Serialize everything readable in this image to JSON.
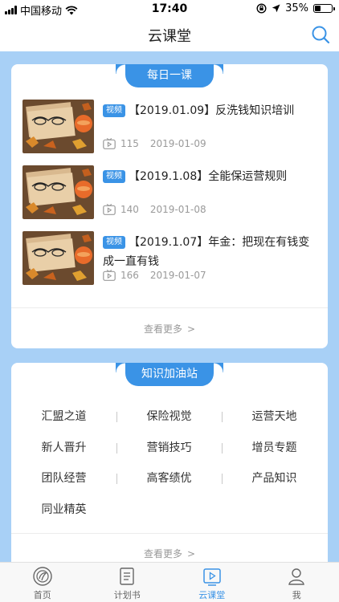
{
  "status_bar": {
    "carrier": "中国移动",
    "time": "17:40",
    "battery_text": "35%",
    "battery_level": 0.35
  },
  "nav": {
    "title": "云课堂",
    "search_icon": "search-icon"
  },
  "daily_lesson": {
    "tab_label": "每日一课",
    "badge_label": "视频",
    "items": [
      {
        "title": "【2019.01.09】反洗钱知识培训",
        "views": "115",
        "date": "2019-01-09"
      },
      {
        "title": "【2019.1.08】全能保运营规则",
        "views": "140",
        "date": "2019-01-08"
      },
      {
        "title": "【2019.1.07】年金：把现在有钱变成一直有钱",
        "views": "166",
        "date": "2019-01-07"
      }
    ],
    "more_label": "查看更多"
  },
  "knowledge": {
    "tab_label": "知识加油站",
    "topics": [
      [
        "汇盟之道",
        "保险视觉",
        "运营天地"
      ],
      [
        "新人晋升",
        "营销技巧",
        "增员专题"
      ],
      [
        "团队经营",
        "高客绩优",
        "产品知识"
      ],
      [
        "同业精英"
      ]
    ],
    "more_label": "查看更多"
  },
  "tab_bar": {
    "items": [
      {
        "label": "首页",
        "icon": "home-icon"
      },
      {
        "label": "计划书",
        "icon": "document-icon"
      },
      {
        "label": "云课堂",
        "icon": "video-icon"
      },
      {
        "label": "我",
        "icon": "user-icon"
      }
    ],
    "active_index": 2
  },
  "colors": {
    "accent": "#3a93e6",
    "page_background": "#a8d0f6"
  }
}
